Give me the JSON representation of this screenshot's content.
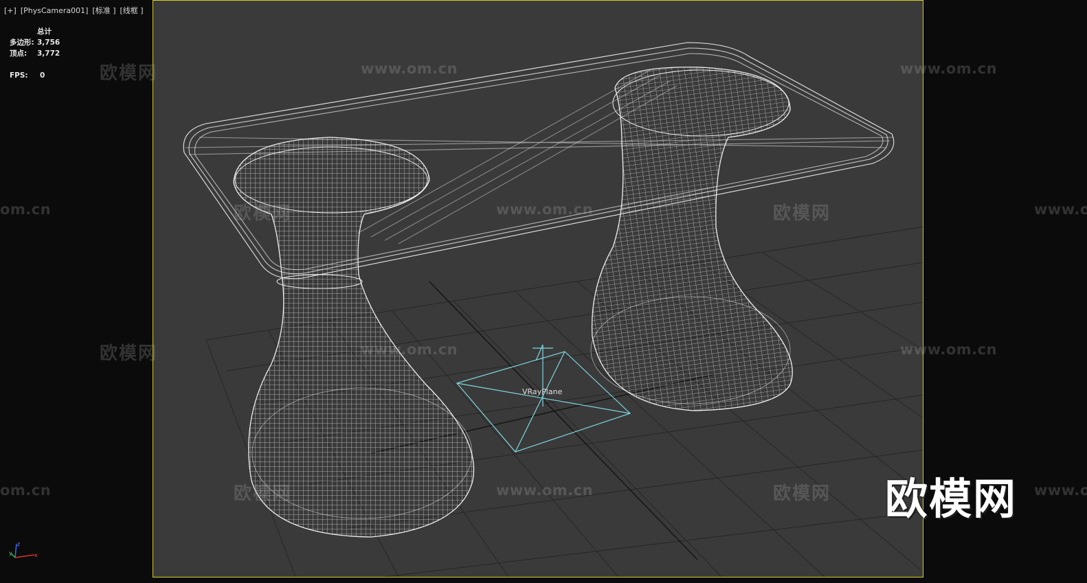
{
  "viewport": {
    "menu_plus": "[+]",
    "camera": "[PhysCamera001]",
    "shading": "[标准 ]",
    "display_mode": "[线框 ]"
  },
  "stats": {
    "header": "总计",
    "polys_label": "多边形:",
    "polys_value": "3,756",
    "verts_label": "顶点:",
    "verts_value": "3,772",
    "fps_label": "FPS:",
    "fps_value": "0"
  },
  "object_label": "VRayPlane",
  "watermarks": {
    "url": "www.om.cn",
    "url_partial": "om.cn",
    "brand": "欧模网"
  },
  "logo": "欧模网",
  "axis": {
    "z": "z",
    "x": "x",
    "y": "y"
  },
  "colors": {
    "viewport_bg": "#3a3a3a",
    "outer_bg": "#0b0b0b",
    "safe_frame": "#d6cf20",
    "wireframe": "#e8e8e8",
    "vray_plane": "#7fd6e0",
    "grid": "#262626"
  }
}
